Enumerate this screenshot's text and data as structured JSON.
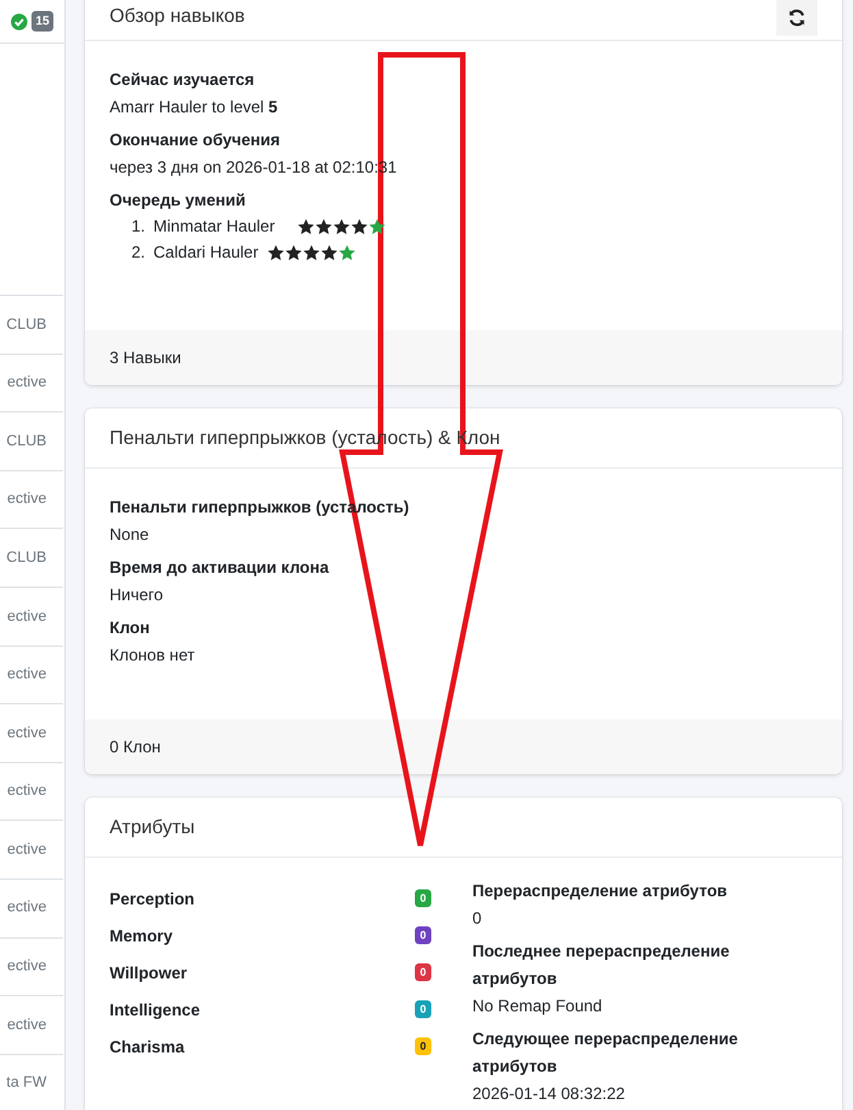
{
  "sidebar": {
    "badge": "15",
    "items": [
      "CLUB",
      "ective",
      "CLUB",
      "ective",
      "CLUB",
      "ective",
      "ective",
      "ective",
      "ective",
      "ective",
      "ective",
      "ective",
      "ective",
      "ta FW"
    ]
  },
  "skills_card": {
    "title": "Обзор навыков",
    "sections": [
      {
        "label": "Сейчас изучается",
        "value": "Amarr Hauler to level **5**"
      },
      {
        "label": "Окончание обучения",
        "value": "через 3 дня on 2026-01-18 at 02:10:31"
      }
    ],
    "queue_label": "Очередь умений",
    "queue": [
      {
        "number": "1.",
        "name": "Minmatar Hauler",
        "stars": 4
      },
      {
        "number": "2.",
        "name": "Caldari Hauler",
        "stars": 4
      }
    ],
    "footer": "3 Навыки"
  },
  "jump_card": {
    "title": "Пенальти гиперпрыжков (усталость) & Клон",
    "sections": [
      {
        "label": "Пенальти гиперпрыжков (усталость)",
        "value": "None"
      },
      {
        "label": "Время до активации клона",
        "value": "Ничего"
      },
      {
        "label": "Клон",
        "value": "Клонов нет"
      }
    ],
    "footer": "0 Клон"
  },
  "attributes_card": {
    "title": "Атрибуты",
    "attributes": [
      {
        "name": "Perception",
        "value": "0",
        "color": "#28a745"
      },
      {
        "name": "Memory",
        "value": "0",
        "color": "#6f42c1"
      },
      {
        "name": "Willpower",
        "value": "0",
        "color": "#dc3545"
      },
      {
        "name": "Intelligence",
        "value": "0",
        "color": "#17a2b8"
      },
      {
        "name": "Charisma",
        "value": "0",
        "color": "#ffc107"
      }
    ],
    "sections": [
      {
        "label": "Перераспределение атрибутов",
        "value": "0"
      },
      {
        "label": "Последнее перераспределение атрибутов",
        "value": "No Remap Found"
      },
      {
        "label": "Следующее перераспределение атрибутов",
        "value": "2026-01-14 08:32:22"
      }
    ]
  }
}
